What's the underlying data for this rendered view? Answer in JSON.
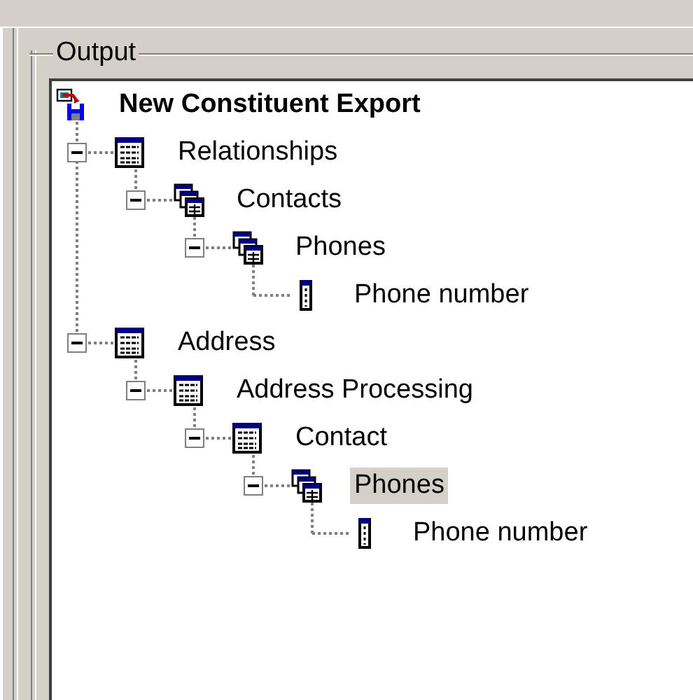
{
  "group_title": "Output",
  "tree": [
    {
      "label": "New Constituent Export",
      "kind": "export",
      "selected": false,
      "children": [
        {
          "label": "Relationships",
          "kind": "table",
          "expanded": true,
          "selected": false,
          "children": [
            {
              "label": "Contacts",
              "kind": "tables",
              "expanded": true,
              "selected": false,
              "children": [
                {
                  "label": "Phones",
                  "kind": "tables",
                  "expanded": true,
                  "selected": false,
                  "children": [
                    {
                      "label": "Phone number",
                      "kind": "field",
                      "selected": false
                    }
                  ]
                }
              ]
            }
          ]
        },
        {
          "label": "Address",
          "kind": "table",
          "expanded": true,
          "selected": false,
          "children": [
            {
              "label": "Address Processing",
              "kind": "table",
              "expanded": true,
              "selected": false,
              "children": [
                {
                  "label": "Contact",
                  "kind": "table",
                  "expanded": true,
                  "selected": false,
                  "children": [
                    {
                      "label": "Phones",
                      "kind": "tables",
                      "expanded": true,
                      "selected": true,
                      "children": [
                        {
                          "label": "Phone number",
                          "kind": "field",
                          "selected": false
                        }
                      ]
                    }
                  ]
                }
              ]
            }
          ]
        }
      ]
    }
  ]
}
